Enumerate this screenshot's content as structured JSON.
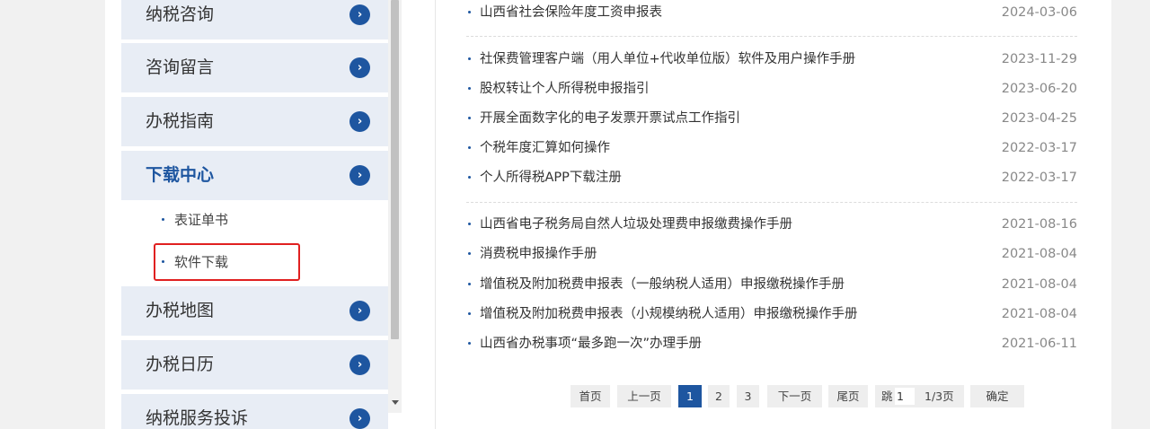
{
  "sidebar": {
    "items": [
      {
        "label": "纳税咨询"
      },
      {
        "label": "咨询留言"
      },
      {
        "label": "办税指南"
      },
      {
        "label": "下载中心"
      },
      {
        "label": "办税地图"
      },
      {
        "label": "办税日历"
      },
      {
        "label": "纳税服务投诉"
      }
    ],
    "subitems": [
      {
        "label": "表证单书"
      },
      {
        "label": "软件下载"
      }
    ]
  },
  "list": {
    "groups": [
      [
        {
          "title": "山西省社会保险年度工资申报表",
          "date": "2024-03-06"
        }
      ],
      [
        {
          "title": "社保费管理客户端（用人单位+代收单位版）软件及用户操作手册",
          "date": "2023-11-29"
        },
        {
          "title": "股权转让个人所得税申报指引",
          "date": "2023-06-20"
        },
        {
          "title": "开展全面数字化的电子发票开票试点工作指引",
          "date": "2023-04-25"
        },
        {
          "title": "个税年度汇算如何操作",
          "date": "2022-03-17"
        },
        {
          "title": "个人所得税APP下载注册",
          "date": "2022-03-17"
        }
      ],
      [
        {
          "title": "山西省电子税务局自然人垃圾处理费申报缴费操作手册",
          "date": "2021-08-16"
        },
        {
          "title": "消费税申报操作手册",
          "date": "2021-08-04"
        },
        {
          "title": "增值税及附加税费申报表（一般纳税人适用）申报缴税操作手册",
          "date": "2021-08-04"
        },
        {
          "title": "增值税及附加税费申报表（小规模纳税人适用）申报缴税操作手册",
          "date": "2021-08-04"
        },
        {
          "title": "山西省办税事项“最多跑一次”办理手册",
          "date": "2021-06-11"
        }
      ]
    ]
  },
  "pagination": {
    "first": "首页",
    "prev": "上一页",
    "pages": [
      "1",
      "2",
      "3"
    ],
    "current": "1",
    "next": "下一页",
    "last": "尾页",
    "jump_label": "跳",
    "jump_value": "1",
    "total": "1/3页",
    "confirm": "确定"
  },
  "colors": {
    "accent": "#1e56a0",
    "highlight": "#e02020"
  }
}
